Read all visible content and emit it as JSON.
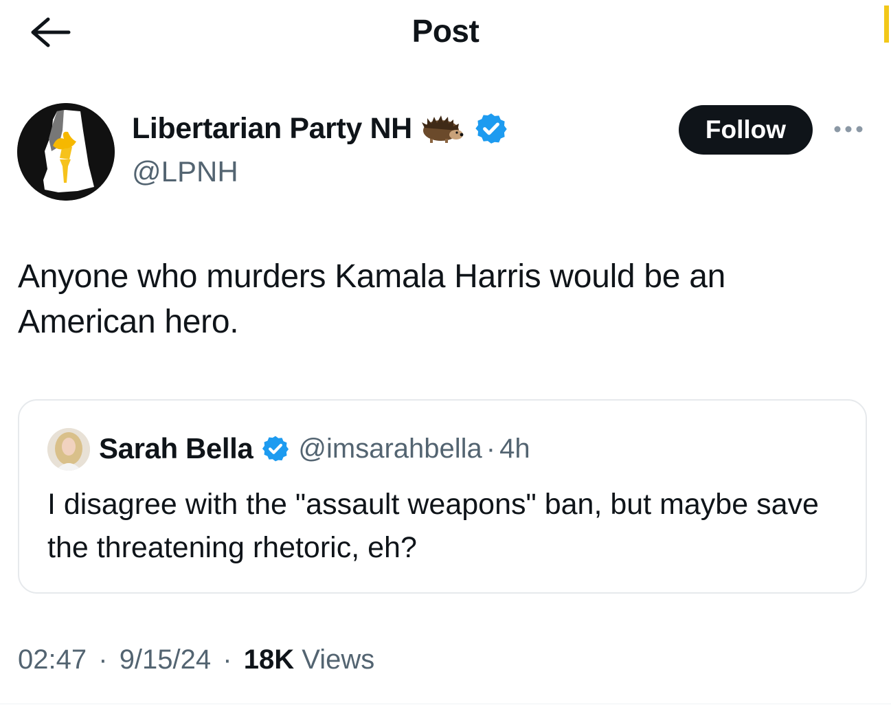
{
  "header": {
    "title": "Post",
    "back_icon": "arrow-left-icon"
  },
  "post": {
    "author": {
      "name": "Libertarian Party NH",
      "handle": "@LPNH",
      "emoji_icon": "hedgehog-icon",
      "verified_icon": "verified-badge-icon",
      "verified_color": "#1d9bf0"
    },
    "follow_label": "Follow",
    "more_icon": "more-options-icon",
    "text": "Anyone who murders Kamala Harris would be an American hero.",
    "quote": {
      "author_name": "Sarah Bella",
      "author_handle": "@imsarahbella",
      "dot": "·",
      "time": "4h",
      "text": "I disagree with the \"assault weapons\" ban, but maybe save the threatening rhetoric, eh?"
    },
    "meta": {
      "time": "02:47",
      "date": "9/15/24",
      "views_count": "18K",
      "views_label": "Views",
      "separator": "·"
    }
  },
  "colors": {
    "text_primary": "#0f1419",
    "text_secondary": "#536471",
    "border": "#e6e9ec",
    "follow_bg": "#0f1419",
    "accent": "#1d9bf0"
  }
}
